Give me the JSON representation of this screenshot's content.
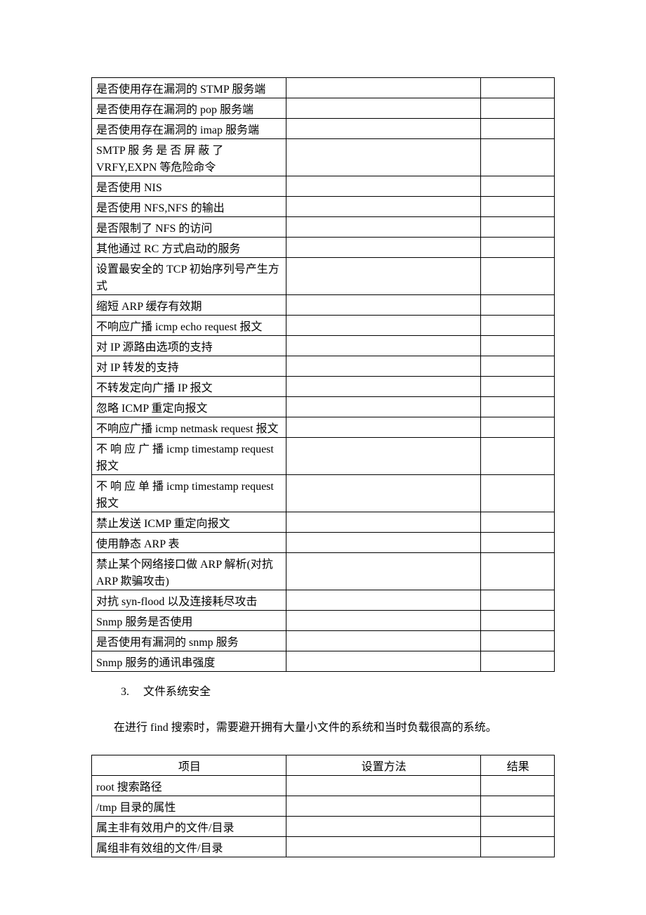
{
  "table1": {
    "rows": [
      {
        "c1": "是否使用存在漏洞的 STMP 服务端",
        "c2": "",
        "c3": ""
      },
      {
        "c1": "是否使用存在漏洞的 pop 服务端",
        "c2": "",
        "c3": ""
      },
      {
        "c1": "是否使用存在漏洞的 imap 服务端",
        "c2": "",
        "c3": ""
      },
      {
        "c1": "SMTP 服 务 是 否 屏 蔽 了 VRFY,EXPN 等危险命令",
        "c2": "",
        "c3": ""
      },
      {
        "c1": "是否使用 NIS",
        "c2": "",
        "c3": ""
      },
      {
        "c1": "是否使用 NFS,NFS 的输出",
        "c2": "",
        "c3": ""
      },
      {
        "c1": "是否限制了 NFS 的访问",
        "c2": "",
        "c3": ""
      },
      {
        "c1": "其他通过 RC 方式启动的服务",
        "c2": "",
        "c3": ""
      },
      {
        "c1": "设置最安全的 TCP 初始序列号产生方式",
        "c2": "",
        "c3": ""
      },
      {
        "c1": "缩短 ARP 缓存有效期",
        "c2": "",
        "c3": ""
      },
      {
        "c1": "不响应广播 icmp echo request 报文",
        "c2": "",
        "c3": ""
      },
      {
        "c1": "对 IP 源路由选项的支持",
        "c2": "",
        "c3": ""
      },
      {
        "c1": "对 IP 转发的支持",
        "c2": "",
        "c3": ""
      },
      {
        "c1": "不转发定向广播 IP 报文",
        "c2": "",
        "c3": ""
      },
      {
        "c1": "忽略 ICMP 重定向报文",
        "c2": "",
        "c3": ""
      },
      {
        "c1": "不响应广播 icmp netmask request 报文",
        "c2": "",
        "c3": ""
      },
      {
        "c1": "不 响 应 广 播 icmp timestamp request 报文",
        "c2": "",
        "c3": ""
      },
      {
        "c1": "不 响 应 单 播 icmp timestamp request 报文",
        "c2": "",
        "c3": ""
      },
      {
        "c1": "禁止发送 ICMP 重定向报文",
        "c2": "",
        "c3": ""
      },
      {
        "c1": "使用静态 ARP 表",
        "c2": "",
        "c3": ""
      },
      {
        "c1": "禁止某个网络接口做 ARP 解析(对抗 ARP 欺骗攻击)",
        "c2": "",
        "c3": ""
      },
      {
        "c1": "对抗 syn-flood 以及连接耗尽攻击",
        "c2": "",
        "c3": ""
      },
      {
        "c1": "Snmp 服务是否使用",
        "c2": "",
        "c3": ""
      },
      {
        "c1": "是否使用有漏洞的 snmp 服务",
        "c2": "",
        "c3": ""
      },
      {
        "c1": "Snmp 服务的通讯串强度",
        "c2": "",
        "c3": ""
      }
    ]
  },
  "section": {
    "number": "3.",
    "title": "文件系统安全"
  },
  "paragraph": "在进行 find 搜索时，需要避开拥有大量小文件的系统和当时负载很高的系统。",
  "table2": {
    "headers": {
      "h1": "项目",
      "h2": "设置方法",
      "h3": "结果"
    },
    "rows": [
      {
        "c1": "root 搜索路径",
        "c2": "",
        "c3": ""
      },
      {
        "c1": "/tmp 目录的属性",
        "c2": "",
        "c3": ""
      },
      {
        "c1": "属主非有效用户的文件/目录",
        "c2": "",
        "c3": ""
      },
      {
        "c1": "属组非有效组的文件/目录",
        "c2": "",
        "c3": ""
      }
    ]
  }
}
